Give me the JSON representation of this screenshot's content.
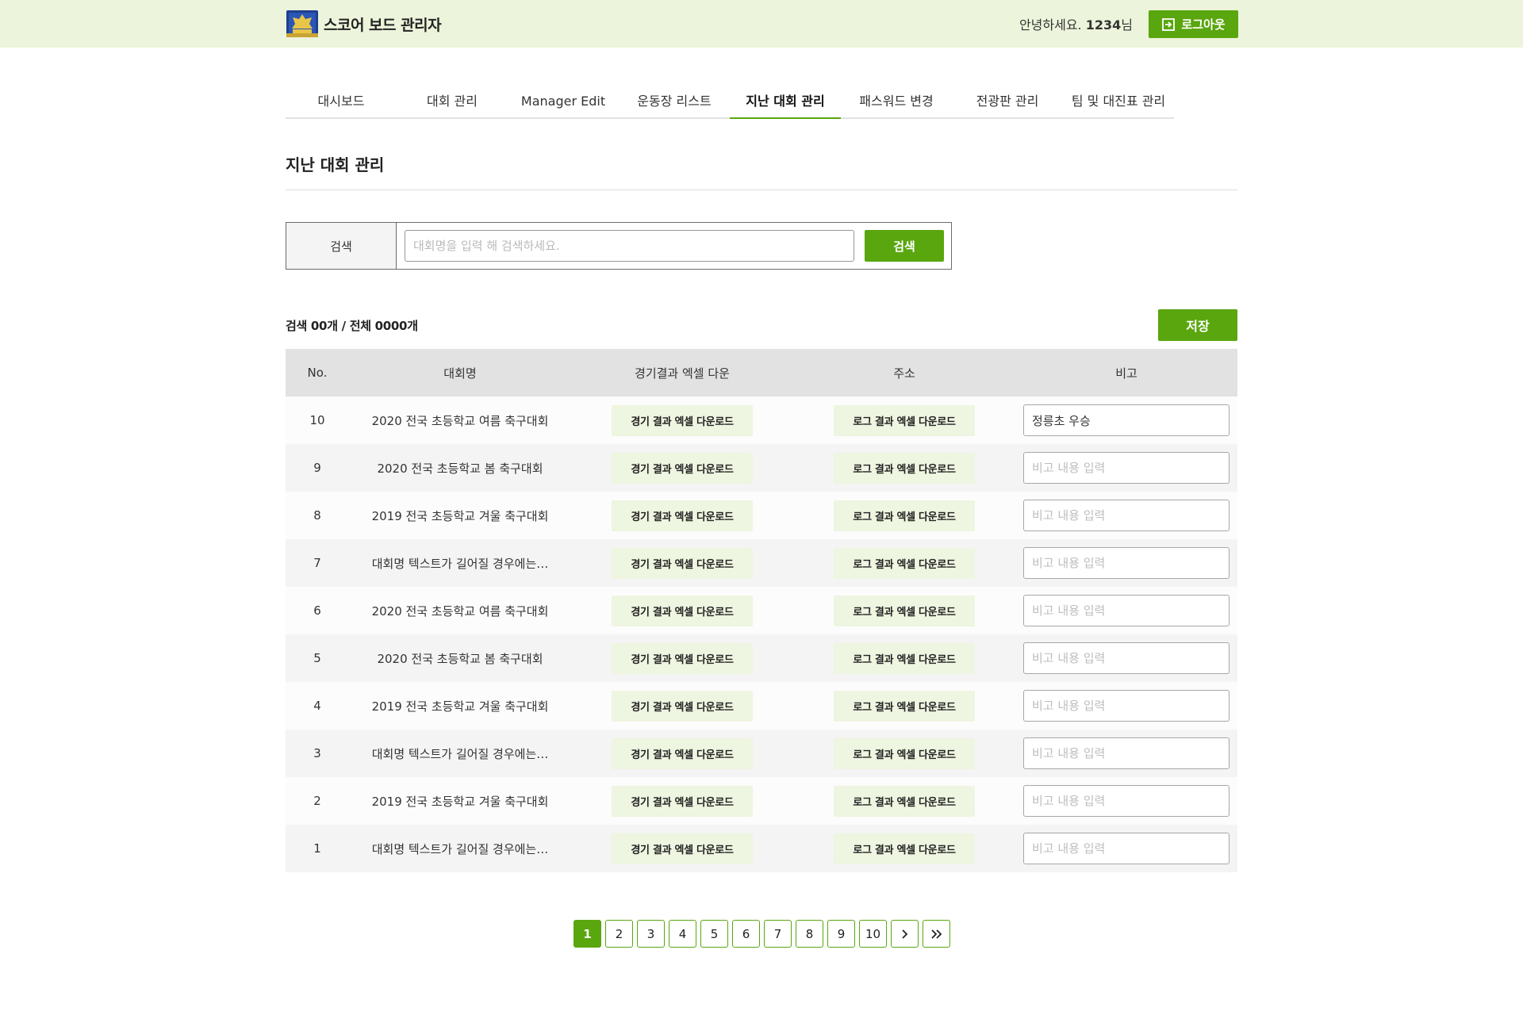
{
  "header": {
    "title": "스코어 보드 관리자",
    "greeting_prefix": "안녕하세요. ",
    "username": "1234",
    "greeting_suffix": "님",
    "logout_label": "로그아웃"
  },
  "nav": {
    "tabs": [
      {
        "label": "대시보드"
      },
      {
        "label": "대회 관리"
      },
      {
        "label": "Manager Edit"
      },
      {
        "label": "운동장 리스트"
      },
      {
        "label": "지난 대회 관리",
        "active": true
      },
      {
        "label": "패스워드 변경"
      },
      {
        "label": "전광판 관리"
      },
      {
        "label": "팀 및 대진표 관리"
      }
    ]
  },
  "page": {
    "title": "지난 대회 관리"
  },
  "search": {
    "label": "검색",
    "placeholder": "대회명을 입력 해 검색하세요.",
    "value": "",
    "button_label": "검색"
  },
  "summary": {
    "count_text": "검색 00개 / 전체 0000개",
    "save_label": "저장"
  },
  "table": {
    "headers": [
      "No.",
      "대회명",
      "경기결과 엑셀 다운",
      "주소",
      "비고"
    ],
    "excel_button_label": "경기 결과 엑셀 다운로드",
    "log_button_label": "로그 결과 엑셀 다운로드",
    "note_placeholder": "비고 내용 입력",
    "rows": [
      {
        "no": "10",
        "name": "2020 전국 초등학교 여름 축구대회",
        "note": "정릉초 우승"
      },
      {
        "no": "9",
        "name": "2020 전국 초등학교 봄 축구대회",
        "note": ""
      },
      {
        "no": "8",
        "name": "2019 전국 초등학교 겨울 축구대회",
        "note": ""
      },
      {
        "no": "7",
        "name": "대회명 텍스트가 길어질 경우에는…",
        "note": ""
      },
      {
        "no": "6",
        "name": "2020 전국 초등학교 여름 축구대회",
        "note": ""
      },
      {
        "no": "5",
        "name": "2020 전국 초등학교 봄 축구대회",
        "note": ""
      },
      {
        "no": "4",
        "name": "2019 전국 초등학교 겨울 축구대회",
        "note": ""
      },
      {
        "no": "3",
        "name": "대회명 텍스트가 길어질 경우에는…",
        "note": ""
      },
      {
        "no": "2",
        "name": "2019 전국 초등학교 겨울 축구대회",
        "note": ""
      },
      {
        "no": "1",
        "name": "대회명 텍스트가 길어질 경우에는…",
        "note": ""
      }
    ]
  },
  "pagination": {
    "pages": [
      "1",
      "2",
      "3",
      "4",
      "5",
      "6",
      "7",
      "8",
      "9",
      "10"
    ],
    "current": "1",
    "next_icon": "chevron-right-icon",
    "last_icon": "double-chevron-right-icon"
  },
  "colors": {
    "accent": "#5aa60e",
    "header_bg": "#ecf4db",
    "download_btn_bg": "#eef5e0"
  }
}
